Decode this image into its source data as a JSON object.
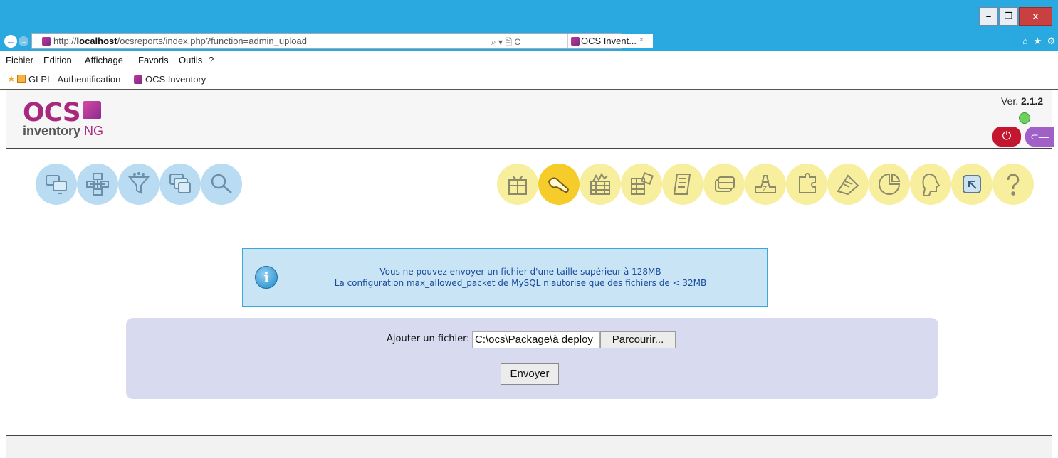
{
  "window": {
    "minimize": "–",
    "maximize": "❐",
    "close": "x"
  },
  "browser": {
    "url_prefix": "http://",
    "url_host": "localhost",
    "url_path": "/ocsreports/index.php?function=admin_upload",
    "address_tools": "⌕ ▾ 🗎 C",
    "tab_title": "OCS Invent...",
    "tab_close": "×",
    "right_icons": "⌂ ★ ⚙"
  },
  "menubar": {
    "items": [
      "Fichier",
      "Edition",
      "Affichage",
      "Favoris",
      "Outils",
      "?"
    ]
  },
  "favorites": {
    "items": [
      "GLPI - Authentification",
      "OCS Inventory"
    ]
  },
  "header": {
    "logo_ocs": "OCS",
    "logo_inventory": "inventory",
    "logo_ng": "NG",
    "version_label": "Ver.",
    "version_number": "2.1.2",
    "logout_icon": "⏻",
    "key_icon": "⊂—"
  },
  "menus": {
    "blue": [
      "computers-icon",
      "groups-icon",
      "filter-icon",
      "multiple-windows-icon",
      "search-icon"
    ],
    "yellow": [
      "package-icon",
      "deployment-icon",
      "security-icon",
      "software-icon",
      "dictionary-icon",
      "registry-icon",
      "admin-data-icon",
      "plugins-icon",
      "config-icon",
      "statistics-icon",
      "users-icon",
      "reset-icon",
      "help-icon"
    ],
    "active": "deployment-icon"
  },
  "info": {
    "icon": "i",
    "line1": "Vous ne pouvez envoyer un fichier d'une taille supérieur à 128MB",
    "line2": "La configuration max_allowed_packet de MySQL n'autorise que des fichiers de < 32MB"
  },
  "upload": {
    "label": "Ajouter un fichier:",
    "file_value": "C:\\ocs\\Package\\à deploy",
    "browse": "Parcourir...",
    "submit": "Envoyer"
  },
  "colors": {
    "chrome_blue": "#29a9e0",
    "ocs_magenta": "#a8287e",
    "info_bg": "#c9e5f5",
    "panel_bg": "#d8dbef"
  }
}
